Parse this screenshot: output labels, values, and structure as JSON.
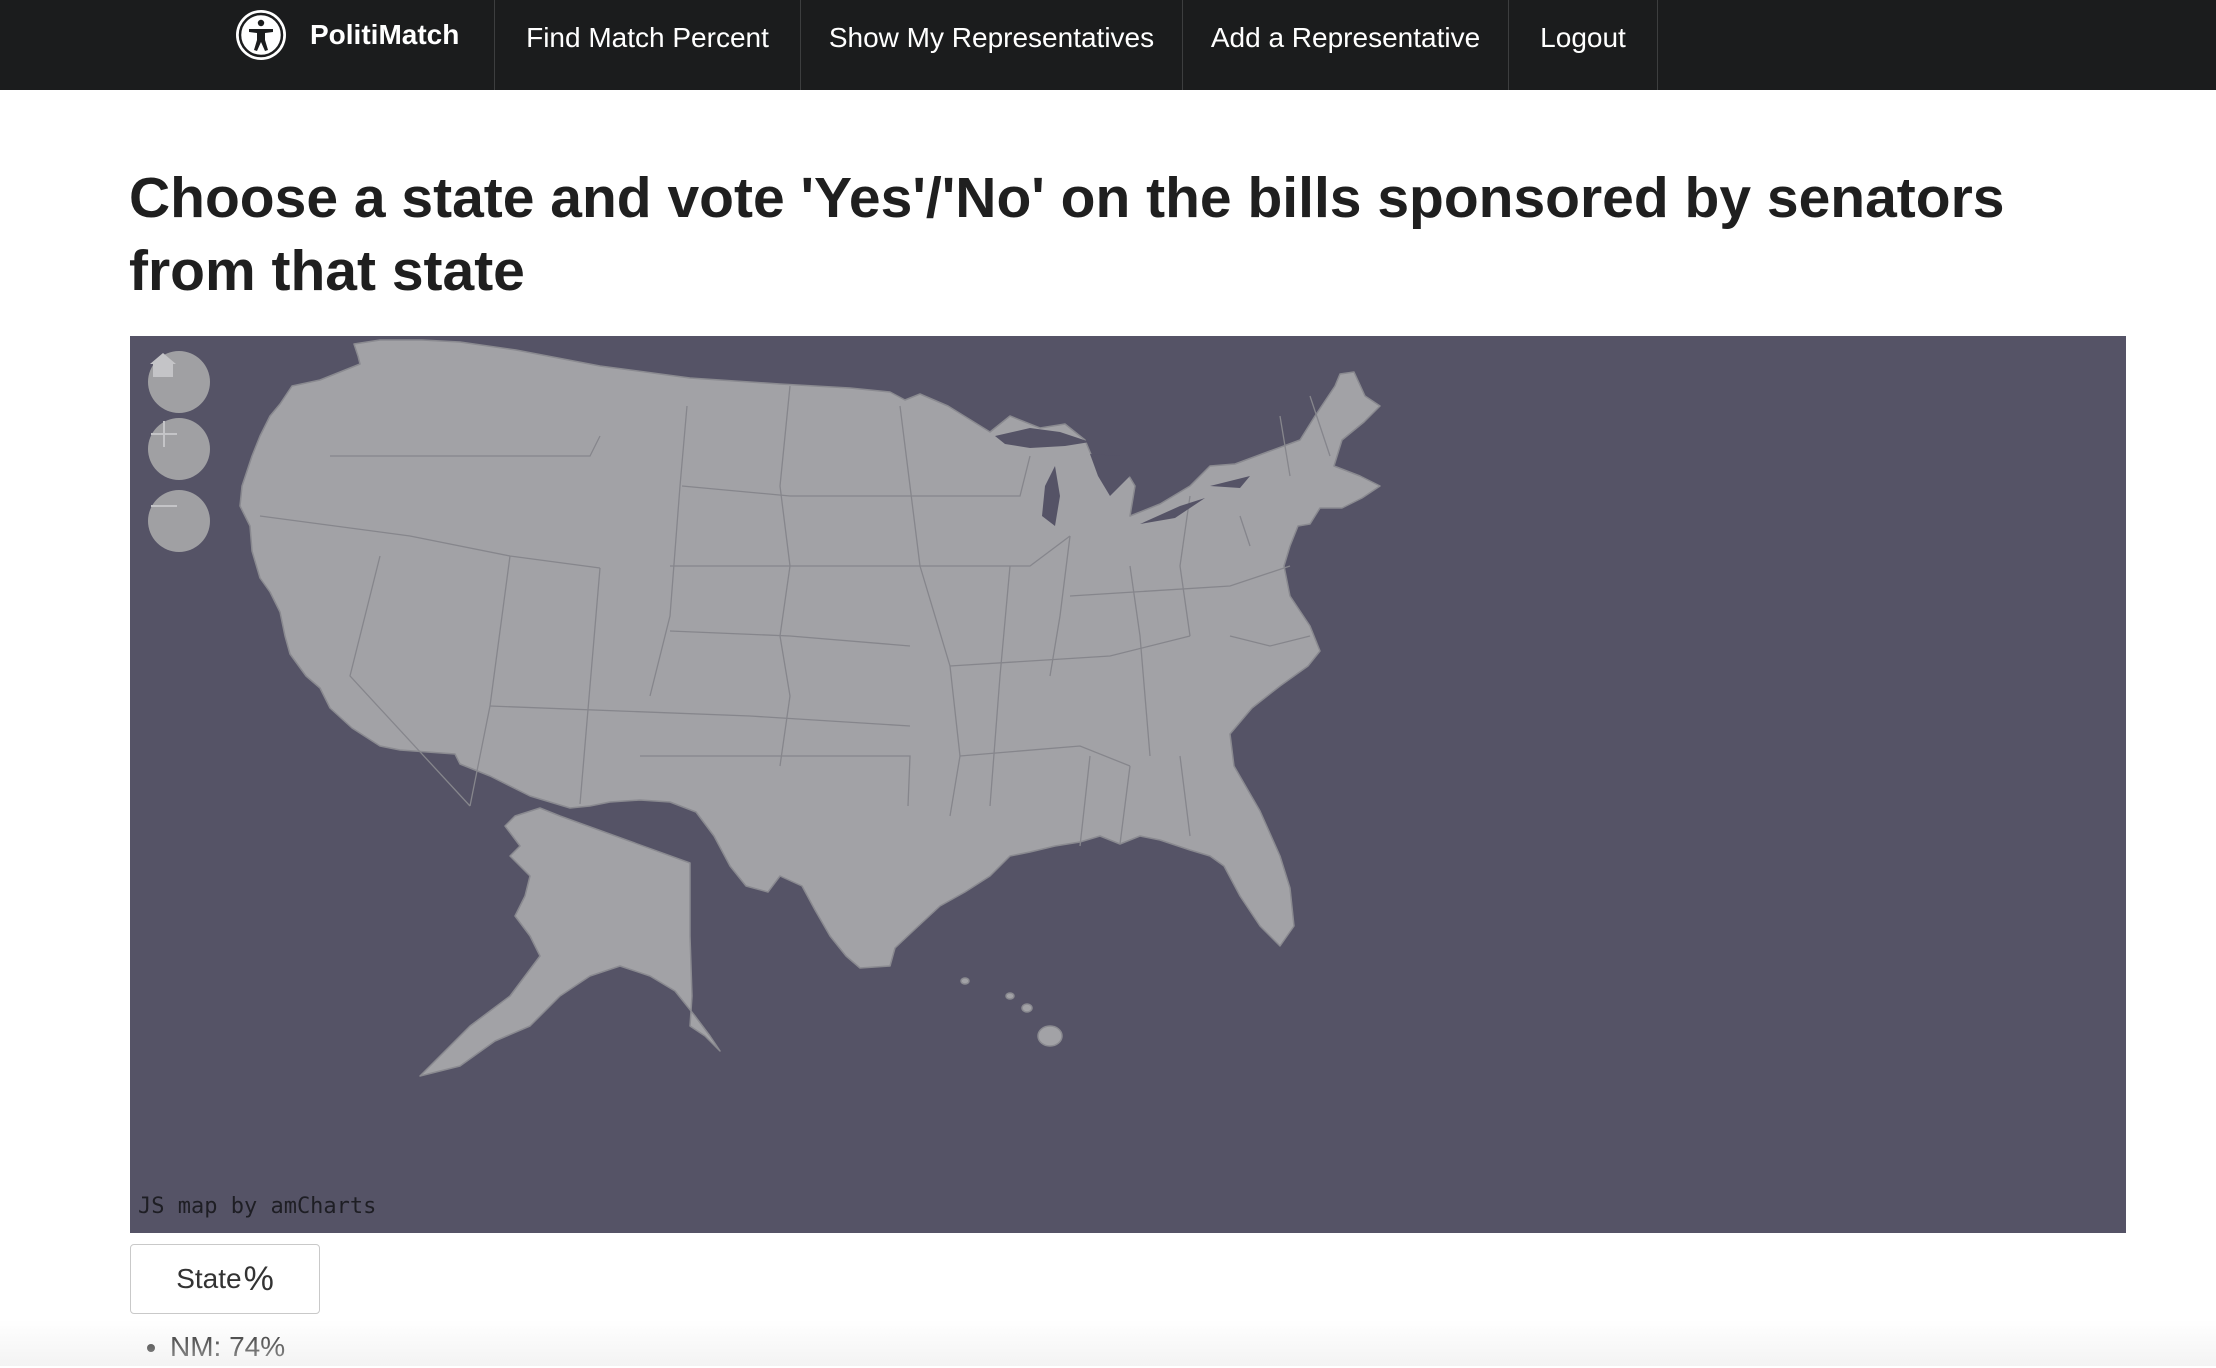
{
  "navbar": {
    "brand": "PolitiMatch",
    "items": [
      {
        "label": "Find Match Percent"
      },
      {
        "label": "Show My Representatives"
      },
      {
        "label": "Add a Representative"
      },
      {
        "label": "Logout"
      }
    ]
  },
  "heading": "Choose a state and vote 'Yes'/'No' on the bills sponsored by senators from that state",
  "map": {
    "credit": "JS map by amCharts",
    "controls": [
      "home-icon",
      "zoom-in-icon",
      "zoom-out-icon"
    ],
    "colors": {
      "background": "#555366",
      "land": "#a2a2a6",
      "border": "#8a8a90"
    }
  },
  "state_button": {
    "label": "State",
    "suffix": "%"
  },
  "results": [
    {
      "text": "NM: 74%"
    }
  ]
}
